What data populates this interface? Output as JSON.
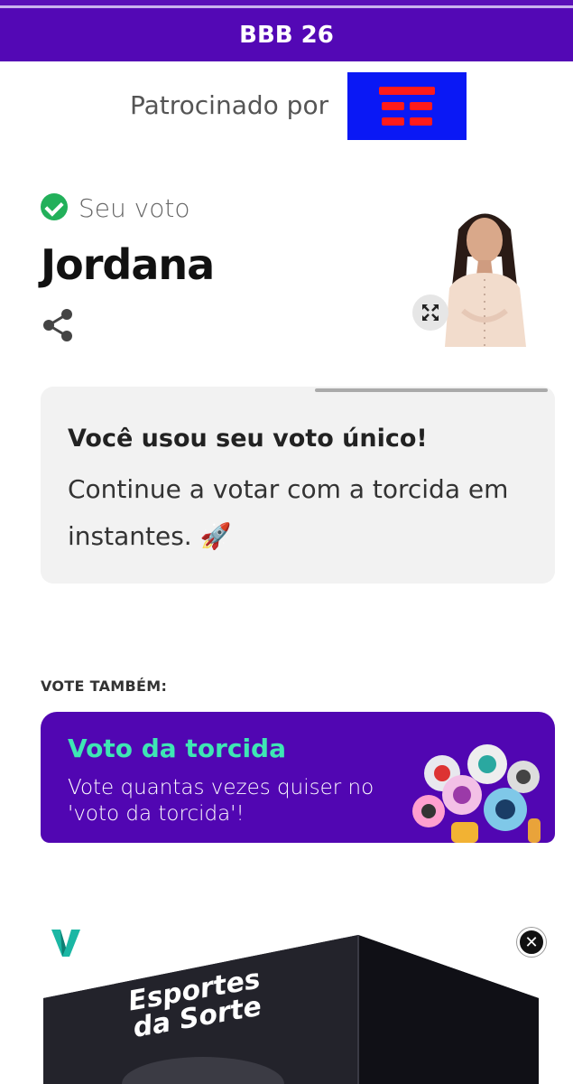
{
  "header": {
    "title": "BBB 26"
  },
  "sponsor": {
    "label": "Patrocinado por",
    "logo_icon": "sponsor-logo"
  },
  "vote": {
    "label": "Seu voto",
    "candidate": "Jordana",
    "share_icon": "share-icon",
    "expand_icon": "expand-icon"
  },
  "notice": {
    "title": "Você usou seu voto único!",
    "body": "Continue a votar com a torcida em instantes. 🚀"
  },
  "also": {
    "label": "VOTE TAMBÉM:"
  },
  "torcida": {
    "title": "Voto da torcida",
    "description": "Vote quantas vezes quiser no 'voto da torcida'!"
  },
  "ad": {
    "brand_text": "Esportes da Sorte",
    "close_label": "✕"
  },
  "colors": {
    "header_bg": "#5308b5",
    "card_bg": "#5106b2",
    "card_title": "#3ee6b4",
    "check_green": "#22b05a"
  }
}
